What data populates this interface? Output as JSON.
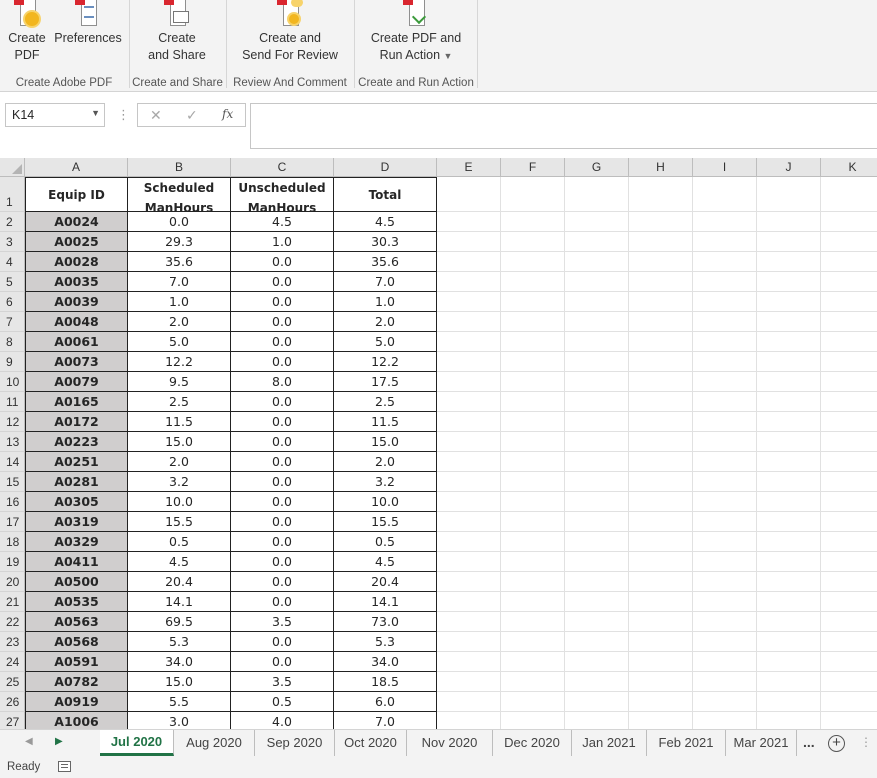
{
  "ribbon": {
    "groups": [
      {
        "label": "Create Adobe PDF",
        "buttons": [
          {
            "line1": "Create",
            "line2": "PDF",
            "icon": "create-pdf-icon"
          },
          {
            "line1": "Preferences",
            "line2": "",
            "icon": "preferences-icon"
          }
        ]
      },
      {
        "label": "Create and Share",
        "buttons": [
          {
            "line1": "Create",
            "line2": "and Share",
            "icon": "create-and-share-icon"
          }
        ]
      },
      {
        "label": "Review And Comment",
        "buttons": [
          {
            "line1": "Create and",
            "line2": "Send For Review",
            "icon": "send-for-review-icon"
          }
        ]
      },
      {
        "label": "Create and Run Action",
        "buttons": [
          {
            "line1": "Create PDF and",
            "line2": "Run Action",
            "icon": "run-action-icon"
          }
        ]
      }
    ]
  },
  "formula_bar": {
    "name_box": "K14",
    "cancel_glyph": "✕",
    "enter_glyph": "✓",
    "fx_glyph": "fx",
    "formula": ""
  },
  "grid": {
    "columns": [
      "A",
      "B",
      "C",
      "D",
      "E",
      "F",
      "G",
      "H",
      "I",
      "J",
      "K"
    ],
    "header_row": {
      "row_number": "1",
      "cells": [
        "Equip ID",
        "Scheduled ManHours",
        "Unscheduled ManHours",
        "Total"
      ]
    },
    "rows": [
      {
        "n": "2",
        "id": "A0024",
        "sched": "0.0",
        "unsched": "4.5",
        "total": "4.5"
      },
      {
        "n": "3",
        "id": "A0025",
        "sched": "29.3",
        "unsched": "1.0",
        "total": "30.3"
      },
      {
        "n": "4",
        "id": "A0028",
        "sched": "35.6",
        "unsched": "0.0",
        "total": "35.6"
      },
      {
        "n": "5",
        "id": "A0035",
        "sched": "7.0",
        "unsched": "0.0",
        "total": "7.0"
      },
      {
        "n": "6",
        "id": "A0039",
        "sched": "1.0",
        "unsched": "0.0",
        "total": "1.0"
      },
      {
        "n": "7",
        "id": "A0048",
        "sched": "2.0",
        "unsched": "0.0",
        "total": "2.0"
      },
      {
        "n": "8",
        "id": "A0061",
        "sched": "5.0",
        "unsched": "0.0",
        "total": "5.0"
      },
      {
        "n": "9",
        "id": "A0073",
        "sched": "12.2",
        "unsched": "0.0",
        "total": "12.2"
      },
      {
        "n": "10",
        "id": "A0079",
        "sched": "9.5",
        "unsched": "8.0",
        "total": "17.5"
      },
      {
        "n": "11",
        "id": "A0165",
        "sched": "2.5",
        "unsched": "0.0",
        "total": "2.5"
      },
      {
        "n": "12",
        "id": "A0172",
        "sched": "11.5",
        "unsched": "0.0",
        "total": "11.5"
      },
      {
        "n": "13",
        "id": "A0223",
        "sched": "15.0",
        "unsched": "0.0",
        "total": "15.0"
      },
      {
        "n": "14",
        "id": "A0251",
        "sched": "2.0",
        "unsched": "0.0",
        "total": "2.0"
      },
      {
        "n": "15",
        "id": "A0281",
        "sched": "3.2",
        "unsched": "0.0",
        "total": "3.2"
      },
      {
        "n": "16",
        "id": "A0305",
        "sched": "10.0",
        "unsched": "0.0",
        "total": "10.0"
      },
      {
        "n": "17",
        "id": "A0319",
        "sched": "15.5",
        "unsched": "0.0",
        "total": "15.5"
      },
      {
        "n": "18",
        "id": "A0329",
        "sched": "0.5",
        "unsched": "0.0",
        "total": "0.5"
      },
      {
        "n": "19",
        "id": "A0411",
        "sched": "4.5",
        "unsched": "0.0",
        "total": "4.5"
      },
      {
        "n": "20",
        "id": "A0500",
        "sched": "20.4",
        "unsched": "0.0",
        "total": "20.4"
      },
      {
        "n": "21",
        "id": "A0535",
        "sched": "14.1",
        "unsched": "0.0",
        "total": "14.1"
      },
      {
        "n": "22",
        "id": "A0563",
        "sched": "69.5",
        "unsched": "3.5",
        "total": "73.0"
      },
      {
        "n": "23",
        "id": "A0568",
        "sched": "5.3",
        "unsched": "0.0",
        "total": "5.3"
      },
      {
        "n": "24",
        "id": "A0591",
        "sched": "34.0",
        "unsched": "0.0",
        "total": "34.0"
      },
      {
        "n": "25",
        "id": "A0782",
        "sched": "15.0",
        "unsched": "3.5",
        "total": "18.5"
      },
      {
        "n": "26",
        "id": "A0919",
        "sched": "5.5",
        "unsched": "0.5",
        "total": "6.0"
      },
      {
        "n": "27",
        "id": "A1006",
        "sched": "3.0",
        "unsched": "4.0",
        "total": "7.0"
      }
    ]
  },
  "sheet_tabs": {
    "active": "Jul 2020",
    "tabs": [
      "Jul 2020",
      "Aug 2020",
      "Sep 2020",
      "Oct 2020",
      "Nov 2020",
      "Dec 2020",
      "Jan 2021",
      "Feb 2021",
      "Mar 2021"
    ],
    "more_label": "...",
    "add_label": "+"
  },
  "status_bar": {
    "ready_text": "Ready"
  },
  "colors": {
    "accent": "#217346",
    "id_fill": "#d0cece",
    "ribbon_bg": "#f3f3f3"
  }
}
